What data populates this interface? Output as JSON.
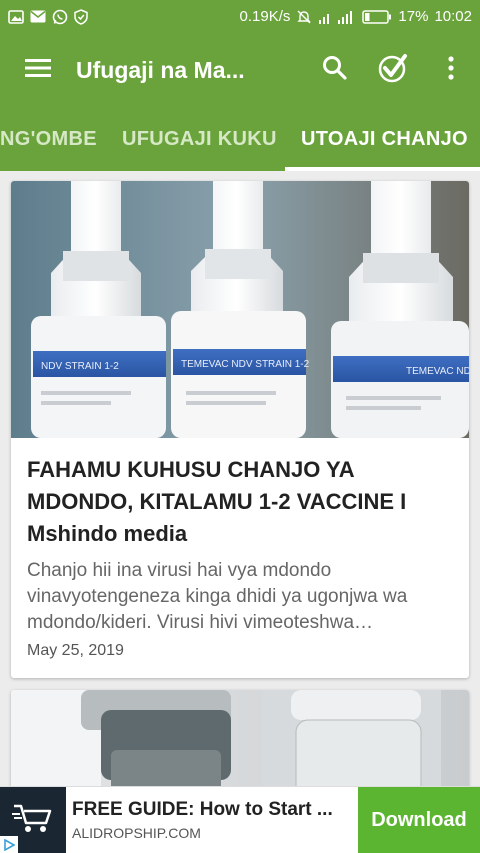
{
  "status_bar": {
    "network_speed": "0.19K/s",
    "battery": "17%",
    "time": "10:02",
    "icons": [
      "image-icon",
      "mail-icon",
      "whatsapp-icon",
      "shield-icon",
      "mute-icon",
      "signal-icon",
      "battery-icon"
    ]
  },
  "toolbar": {
    "title": "Ufugaji na Ma...",
    "actions": [
      "search-icon",
      "check-badge-icon",
      "more-vert-icon"
    ]
  },
  "tabs": {
    "items": [
      {
        "label": "NG'OMBE"
      },
      {
        "label": "UFUGAJI KUKU"
      },
      {
        "label": "UTOAJI CHANJO"
      }
    ],
    "active_index": 2
  },
  "articles": [
    {
      "title": "FAHAMU KUHUSU CHANJO YA MDONDO, KITALAMU 1-2 VACCINE I Mshindo media",
      "excerpt": "Chanjo hii ina virusi hai vya mdondo vinavyotengeneza kinga dhidi ya ugonjwa wa mdondo/kideri. Virusi hivi vimeoteshwa…",
      "date": "May 25, 2019",
      "image_labels": [
        "NDV STRAIN 1-2",
        "TEMEVAC NDV STRAIN 1-2",
        "TEMEVAC NDV S"
      ]
    }
  ],
  "ad": {
    "headline": "FREE GUIDE: How to Start ...",
    "domain": "ALIDROPSHIP.COM",
    "cta": "Download"
  },
  "colors": {
    "primary": "#6aa33b",
    "ad_cta": "#5cb531"
  }
}
